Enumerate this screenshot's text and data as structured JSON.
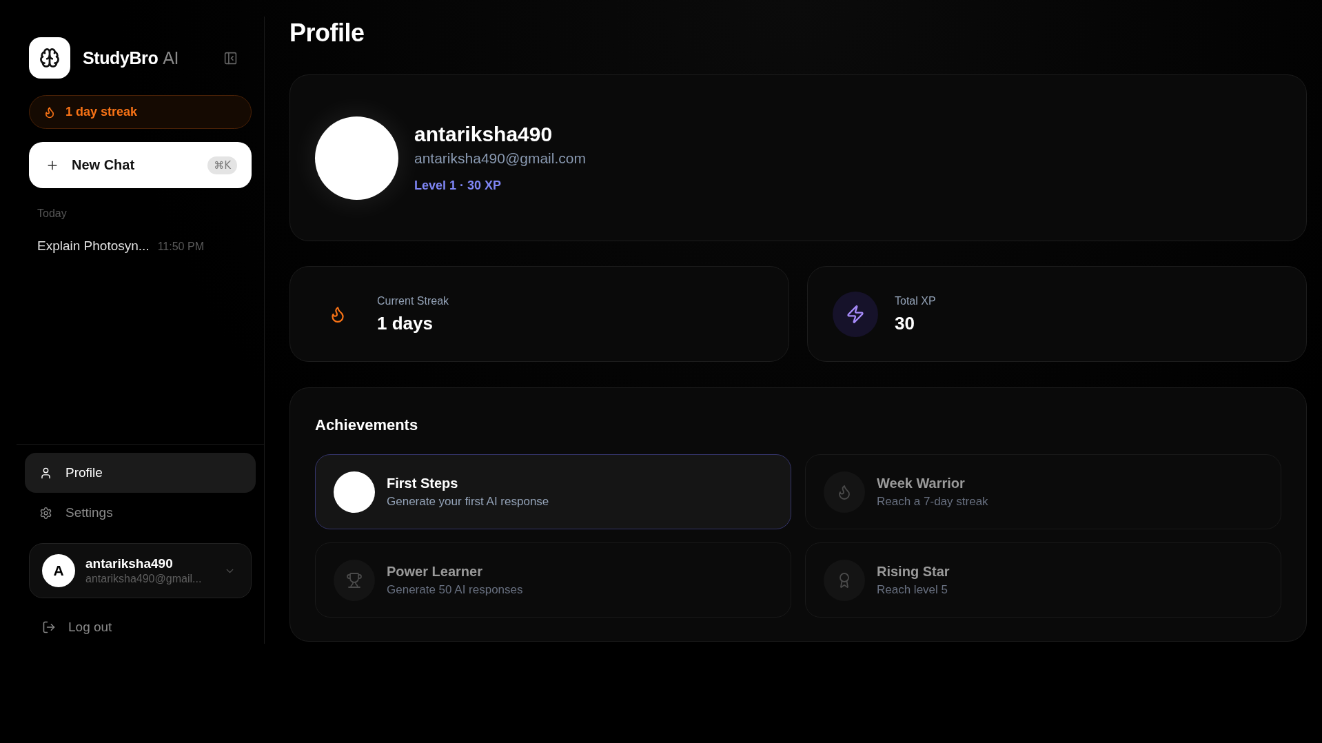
{
  "sidebar": {
    "brand": {
      "name": "StudyBro",
      "suffix": "AI"
    },
    "streak": "1 day streak",
    "new_chat": {
      "label": "New Chat",
      "shortcut": "⌘K"
    },
    "history": [
      {
        "group": "Today",
        "chats": [
          {
            "title": "Explain Photosyn...",
            "time": "11:50 PM"
          }
        ]
      }
    ],
    "nav": [
      {
        "kind": "profile",
        "label": "Profile",
        "selected": true
      },
      {
        "kind": "settings",
        "label": "Settings",
        "selected": false
      }
    ],
    "account": {
      "initial": "A",
      "name": "antariksha490",
      "email": "antariksha490@gmail..."
    },
    "logout": "Log out"
  },
  "page": {
    "title": "Profile"
  },
  "profile": {
    "name": "antariksha490",
    "email": "antariksha490@gmail.com",
    "level": "Level 1 · 30 XP"
  },
  "stats": [
    {
      "kind": "streak",
      "label": "Current Streak",
      "value": "1 days"
    },
    {
      "kind": "xp",
      "label": "Total XP",
      "value": "30"
    }
  ],
  "achievements": {
    "title": "Achievements",
    "items": [
      {
        "kind": "circle",
        "title": "First Steps",
        "description": "Generate your first AI response",
        "unlocked": true
      },
      {
        "kind": "flame",
        "title": "Week Warrior",
        "description": "Reach a 7-day streak",
        "unlocked": false
      },
      {
        "kind": "trophy",
        "title": "Power Learner",
        "description": "Generate 50 AI responses",
        "unlocked": false
      },
      {
        "kind": "medal",
        "title": "Rising Star",
        "description": "Reach level 5",
        "unlocked": false
      }
    ]
  }
}
